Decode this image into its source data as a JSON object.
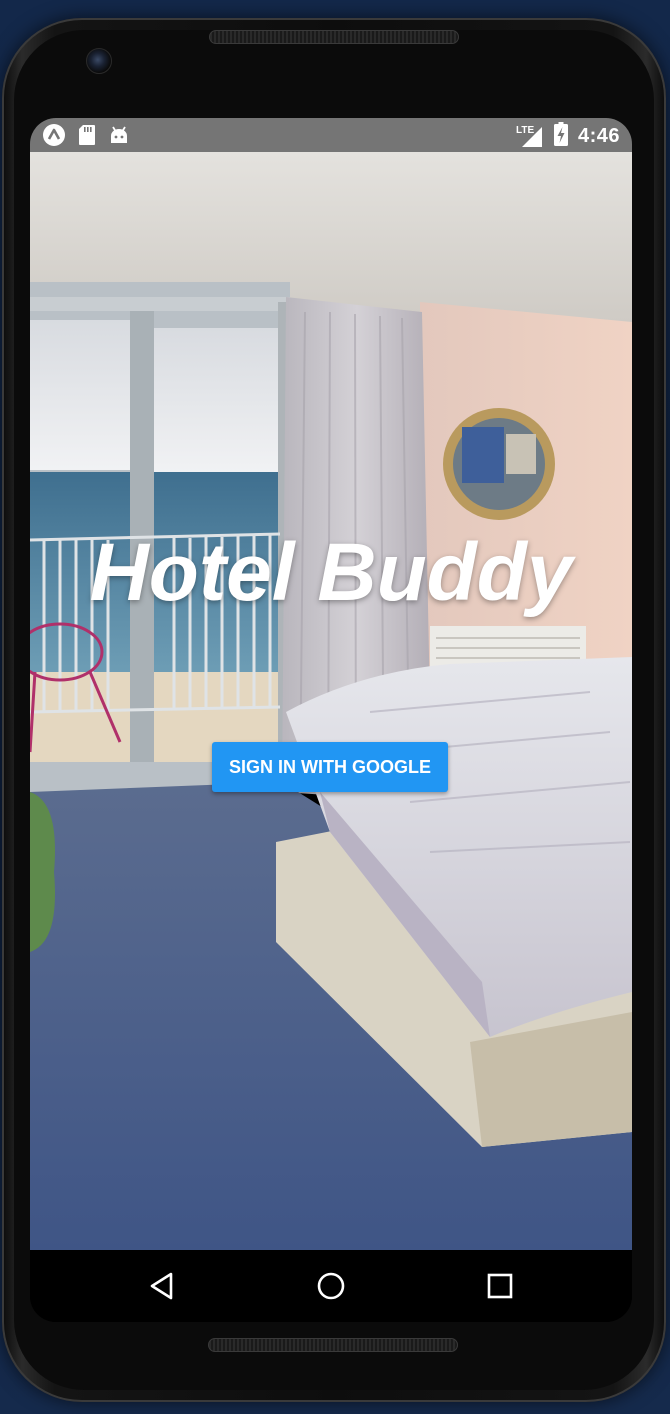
{
  "status_bar": {
    "time": "4:46",
    "network": "LTE",
    "left_icons": [
      "app-icon",
      "sd-card-icon",
      "android-icon"
    ],
    "right_icons": [
      "signal-icon",
      "battery-charging-icon"
    ]
  },
  "app": {
    "title": "Hotel Buddy",
    "signin_label": "SIGN IN WITH GOOGLE",
    "accent_color": "#2196f3"
  },
  "nav_bar": {
    "buttons": [
      "back-icon",
      "home-icon",
      "recents-icon"
    ]
  }
}
